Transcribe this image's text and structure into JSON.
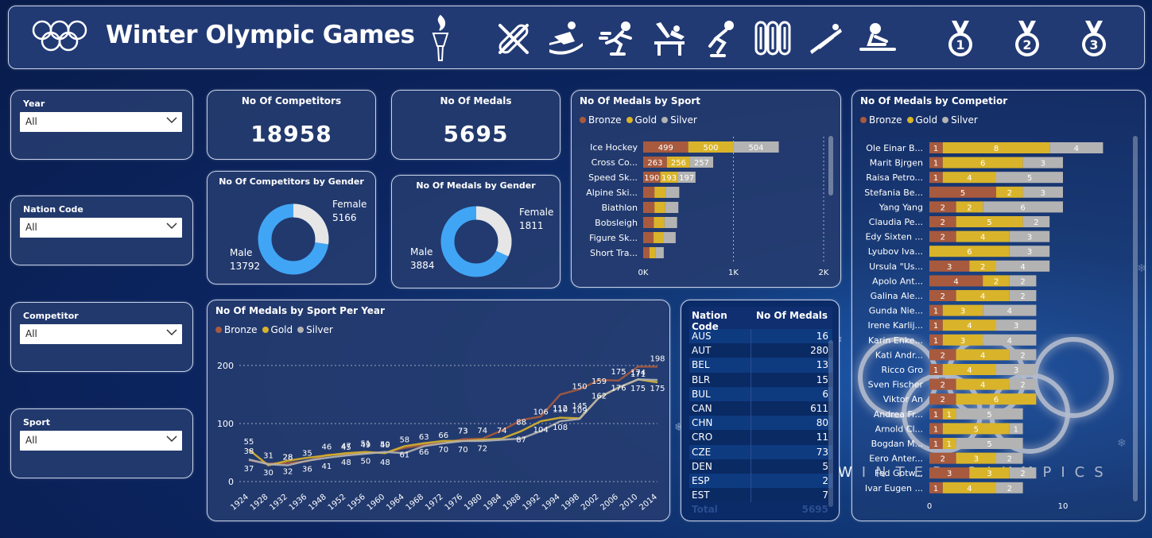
{
  "header": {
    "title": "Winter Olympic Games",
    "icons": [
      "olympic-rings-icon",
      "torch-icon",
      "ski-snowboard-icon",
      "snowboarder-icon",
      "speed-skater-icon",
      "ski-jump-icon",
      "short-track-icon",
      "bobsleigh-icon",
      "ski-jumper-icon",
      "luge-icon",
      "gold-medal-icon",
      "silver-medal-icon",
      "bronze-medal-icon"
    ],
    "medal_numbers": [
      "1",
      "2",
      "3"
    ]
  },
  "slicers": [
    {
      "label": "Year",
      "value": "All"
    },
    {
      "label": "Nation Code",
      "value": "All"
    },
    {
      "label": "Competitor",
      "value": "All"
    },
    {
      "label": "Sport",
      "value": "All"
    }
  ],
  "cards": {
    "competitors": {
      "title": "No Of Competitors",
      "value": "18958"
    },
    "medals": {
      "title": "No Of Medals",
      "value": "5695"
    }
  },
  "colors": {
    "bronze": "#a85a3e",
    "gold": "#d9b42a",
    "silver": "#b3b3b3",
    "donut_male": "#41a5f5",
    "donut_female": "#e6e6e6"
  },
  "legend": [
    "Bronze",
    "Gold",
    "Silver"
  ],
  "donut_competitors": {
    "title": "No Of Competitors by Gender",
    "female_label": "Female",
    "female_value": "5166",
    "male_label": "Male",
    "male_value": "13792"
  },
  "donut_medals": {
    "title": "No Of Medals by Gender",
    "female_label": "Female",
    "female_value": "1811",
    "male_label": "Male",
    "male_value": "3884"
  },
  "chart_data": [
    {
      "type": "bar",
      "orientation": "horizontal-stacked",
      "title": "No Of Medals by Sport",
      "categories": [
        "Ice Hockey",
        "Cross Co...",
        "Speed Sk...",
        "Alpine Ski...",
        "Biathlon",
        "Bobsleigh",
        "Figure Sk...",
        "Short Tra..."
      ],
      "series": [
        {
          "name": "Bronze",
          "values": [
            499,
            263,
            190,
            125,
            125,
            118,
            115,
            70
          ]
        },
        {
          "name": "Gold",
          "values": [
            500,
            256,
            193,
            125,
            120,
            118,
            110,
            70
          ]
        },
        {
          "name": "Silver",
          "values": [
            504,
            257,
            197,
            150,
            145,
            140,
            135,
            88
          ]
        }
      ],
      "data_labels_shown": [
        [
          499,
          500,
          504
        ],
        [
          263,
          256,
          257
        ],
        [
          190,
          193,
          197
        ]
      ],
      "xticks": [
        "0K",
        "1K",
        "2K"
      ],
      "xlim": [
        0,
        2000
      ]
    },
    {
      "type": "line",
      "title": "No Of Medals by Sport Per Year",
      "x": [
        "1924",
        "1928",
        "1932",
        "1936",
        "1948",
        "1952",
        "1956",
        "1960",
        "1964",
        "1968",
        "1972",
        "1976",
        "1980",
        "1984",
        "1988",
        "1992",
        "1994",
        "1998",
        "2002",
        "2006",
        "2010",
        "2014"
      ],
      "series": [
        {
          "name": "Bronze",
          "values": [
            37,
            31,
            32,
            35,
            46,
            47,
            50,
            50,
            58,
            63,
            66,
            73,
            74,
            88,
            106,
            112,
            150,
            159,
            175,
            174,
            198,
            198
          ]
        },
        {
          "name": "Gold",
          "values": [
            55,
            28,
            36,
            41,
            45,
            49,
            51,
            49,
            61,
            66,
            70,
            70,
            72,
            74,
            87,
            104,
            110,
            109,
            145,
            162,
            176,
            171
          ]
        },
        {
          "name": "Silver",
          "values": [
            38,
            30,
            28,
            36,
            41,
            45,
            48,
            51,
            49,
            61,
            66,
            70,
            70,
            72,
            74,
            87,
            104,
            108,
            145,
            162,
            176,
            175
          ]
        }
      ],
      "point_labels": [
        {
          "label": "55",
          "xi": 0,
          "y": 55
        },
        {
          "label": "37",
          "xi": 0,
          "y": 37
        },
        {
          "label": "38",
          "xi": 0,
          "y": 38
        },
        {
          "label": "31",
          "xi": 1,
          "y": 31
        },
        {
          "label": "30",
          "xi": 1,
          "y": 30
        },
        {
          "label": "28",
          "xi": 2,
          "y": 28
        },
        {
          "label": "32",
          "xi": 2,
          "y": 32
        },
        {
          "label": "28",
          "xi": 2,
          "y": 28
        },
        {
          "label": "35",
          "xi": 3,
          "y": 35
        },
        {
          "label": "36",
          "xi": 3,
          "y": 36
        },
        {
          "label": "46",
          "xi": 4,
          "y": 46
        },
        {
          "label": "41",
          "xi": 4,
          "y": 41
        },
        {
          "label": "47",
          "xi": 5,
          "y": 47
        },
        {
          "label": "48",
          "xi": 5,
          "y": 48
        },
        {
          "label": "45",
          "xi": 5,
          "y": 45
        },
        {
          "label": "49",
          "xi": 6,
          "y": 49
        },
        {
          "label": "50",
          "xi": 6,
          "y": 50
        },
        {
          "label": "51",
          "xi": 6,
          "y": 51
        },
        {
          "label": "50",
          "xi": 7,
          "y": 50
        },
        {
          "label": "48",
          "xi": 7,
          "y": 48
        },
        {
          "label": "49",
          "xi": 7,
          "y": 49
        },
        {
          "label": "58",
          "xi": 8,
          "y": 58
        },
        {
          "label": "61",
          "xi": 8,
          "y": 61
        },
        {
          "label": "63",
          "xi": 9,
          "y": 63
        },
        {
          "label": "66",
          "xi": 9,
          "y": 66
        },
        {
          "label": "66",
          "xi": 10,
          "y": 66
        },
        {
          "label": "70",
          "xi": 10,
          "y": 70
        },
        {
          "label": "73",
          "xi": 11,
          "y": 73
        },
        {
          "label": "70",
          "xi": 11,
          "y": 70
        },
        {
          "label": "74",
          "xi": 12,
          "y": 74
        },
        {
          "label": "72",
          "xi": 12,
          "y": 72
        },
        {
          "label": "73",
          "xi": 11,
          "y": 73
        },
        {
          "label": "74",
          "xi": 13,
          "y": 74
        },
        {
          "label": "88",
          "xi": 14,
          "y": 88
        },
        {
          "label": "87",
          "xi": 14,
          "y": 87
        },
        {
          "label": "106",
          "xi": 15,
          "y": 106
        },
        {
          "label": "104",
          "xi": 15,
          "y": 104
        },
        {
          "label": "112",
          "xi": 16,
          "y": 112
        },
        {
          "label": "108",
          "xi": 16,
          "y": 108
        },
        {
          "label": "110",
          "xi": 16,
          "y": 110
        },
        {
          "label": "150",
          "xi": 17,
          "y": 150
        },
        {
          "label": "145",
          "xi": 17,
          "y": 145
        },
        {
          "label": "109",
          "xi": 17,
          "y": 109
        },
        {
          "label": "159",
          "xi": 18,
          "y": 159
        },
        {
          "label": "162",
          "xi": 18,
          "y": 162
        },
        {
          "label": "175",
          "xi": 19,
          "y": 175
        },
        {
          "label": "176",
          "xi": 19,
          "y": 176
        },
        {
          "label": "174",
          "xi": 20,
          "y": 174
        },
        {
          "label": "175",
          "xi": 20,
          "y": 175
        },
        {
          "label": "171",
          "xi": 20,
          "y": 171
        },
        {
          "label": "198",
          "xi": 21,
          "y": 198
        },
        {
          "label": "175",
          "xi": 21,
          "y": 175
        }
      ],
      "yticks": [
        "0",
        "100",
        "200"
      ],
      "ylim": [
        0,
        230
      ]
    },
    {
      "type": "bar",
      "orientation": "horizontal-stacked",
      "title": "No Of Medals by Competior",
      "categories": [
        "Ole Einar B...",
        "Marit Bjrgen",
        "Raisa Petro...",
        "Stefania Be...",
        "Yang Yang",
        "Claudia Pe...",
        "Edy Sixten ...",
        "Lyubov Iva...",
        "Ursula \"Us...",
        "Apolo Ant...",
        "Galina Ale...",
        "Gunda Nie...",
        "Irene Karlij...",
        "Karin Enke...",
        "Kati Andr...",
        "Ricco Gro",
        "Sven Fischer",
        "Viktor An",
        "Andrea Fr...",
        "Arnold Cl...",
        "Bogdan M...",
        "Eero Anter...",
        "Fed Gotw...",
        "Ivar Eugen ..."
      ],
      "series": [
        {
          "name": "Bronze",
          "values": [
            1,
            1,
            1,
            5,
            2,
            2,
            2,
            0,
            3,
            4,
            2,
            1,
            1,
            1,
            2,
            1,
            2,
            2,
            1,
            1,
            1,
            2,
            3,
            1
          ]
        },
        {
          "name": "Gold",
          "values": [
            8,
            6,
            4,
            2,
            2,
            5,
            4,
            6,
            2,
            2,
            4,
            3,
            4,
            3,
            4,
            4,
            4,
            6,
            1,
            5,
            1,
            3,
            3,
            4
          ]
        },
        {
          "name": "Silver",
          "values": [
            4,
            3,
            5,
            3,
            6,
            2,
            3,
            3,
            4,
            2,
            2,
            4,
            3,
            4,
            2,
            3,
            2,
            0,
            5,
            1,
            5,
            2,
            2,
            2
          ]
        }
      ],
      "xticks": [
        "0",
        "10"
      ],
      "xlim": [
        0,
        15
      ]
    }
  ],
  "table": {
    "headers": [
      "Nation Code",
      "No Of Medals"
    ],
    "rows": [
      [
        "AUS",
        "16"
      ],
      [
        "AUT",
        "280"
      ],
      [
        "BEL",
        "13"
      ],
      [
        "BLR",
        "15"
      ],
      [
        "BUL",
        "6"
      ],
      [
        "CAN",
        "611"
      ],
      [
        "CHN",
        "80"
      ],
      [
        "CRO",
        "11"
      ],
      [
        "CZE",
        "73"
      ],
      [
        "DEN",
        "5"
      ],
      [
        "ESP",
        "2"
      ],
      [
        "EST",
        "7"
      ]
    ],
    "total_label": "Total",
    "total_value": "5695"
  },
  "background_text": "WINTER OLYMPICS"
}
